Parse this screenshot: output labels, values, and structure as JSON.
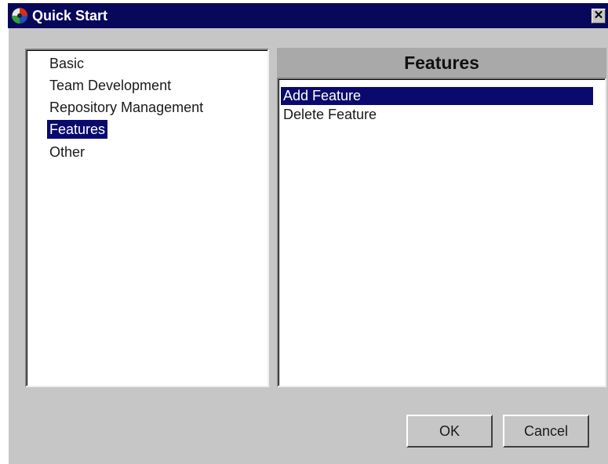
{
  "window": {
    "title": "Quick Start",
    "close_glyph": "✕",
    "icon": "app-icon"
  },
  "categories": {
    "items": [
      {
        "label": "Basic",
        "selected": false
      },
      {
        "label": "Team Development",
        "selected": false
      },
      {
        "label": "Repository Management",
        "selected": false
      },
      {
        "label": "Features",
        "selected": true
      },
      {
        "label": "Other",
        "selected": false
      }
    ]
  },
  "features_panel": {
    "header": "Features",
    "items": [
      {
        "label": "Add Feature",
        "selected": true
      },
      {
        "label": "Delete Feature",
        "selected": false
      }
    ]
  },
  "buttons": {
    "ok": "OK",
    "cancel": "Cancel"
  },
  "colors": {
    "titlebar": "#08085a",
    "selection": "#0a0a6e",
    "dialog_face": "#c6c6c6",
    "header_face": "#a9a9a9"
  }
}
